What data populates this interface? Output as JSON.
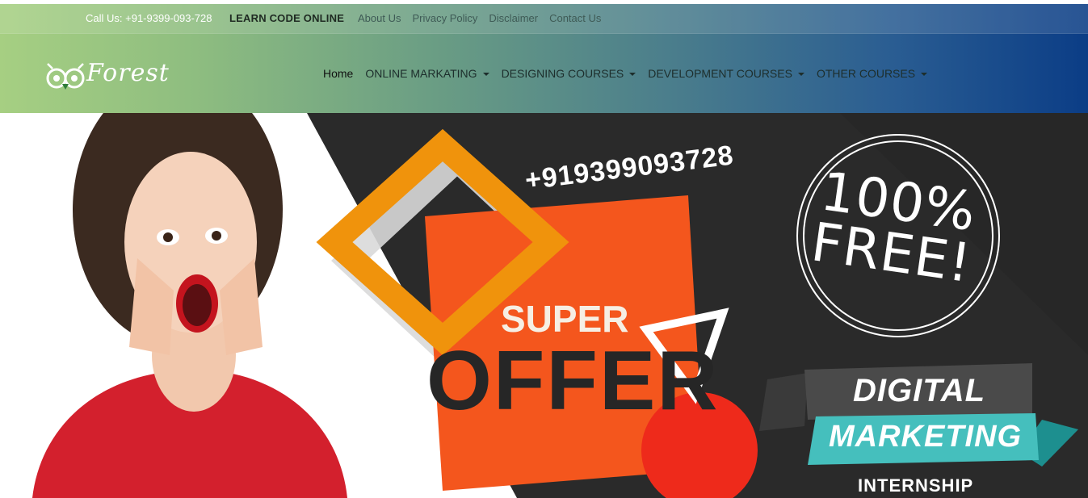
{
  "topbar": {
    "call_text": "Call Us: +91-9399-093-728",
    "learn_text": "LEARN CODE ONLINE",
    "links": [
      "About Us",
      "Privacy Policy",
      "Disclaimer",
      "Contact Us"
    ]
  },
  "logo": {
    "text": "Forest",
    "icon": "owl-icon"
  },
  "nav": {
    "items": [
      {
        "label": "Home",
        "dropdown": false
      },
      {
        "label": "ONLINE MARKATING",
        "dropdown": true
      },
      {
        "label": "DESIGNING COURSES",
        "dropdown": true
      },
      {
        "label": "DEVELOPMENT COURSES",
        "dropdown": true
      },
      {
        "label": "OTHER COURSES",
        "dropdown": true
      }
    ]
  },
  "hero": {
    "phone": "+919399093728",
    "super": "SUPER",
    "offer": "OFFER",
    "free_line1": "100%",
    "free_line2": "FREE!",
    "ribbon_line1": "DIGITAL",
    "ribbon_line2": "MARKETING",
    "ribbon_line3": "INTERNSHIP"
  },
  "colors": {
    "header_start": "#a6cf82",
    "header_end": "#0b3d86",
    "dark_panel": "#2a2a2a",
    "orange": "#f4561d",
    "gold": "#f0930c",
    "red": "#ee2a1b",
    "teal": "#45bfbd"
  }
}
